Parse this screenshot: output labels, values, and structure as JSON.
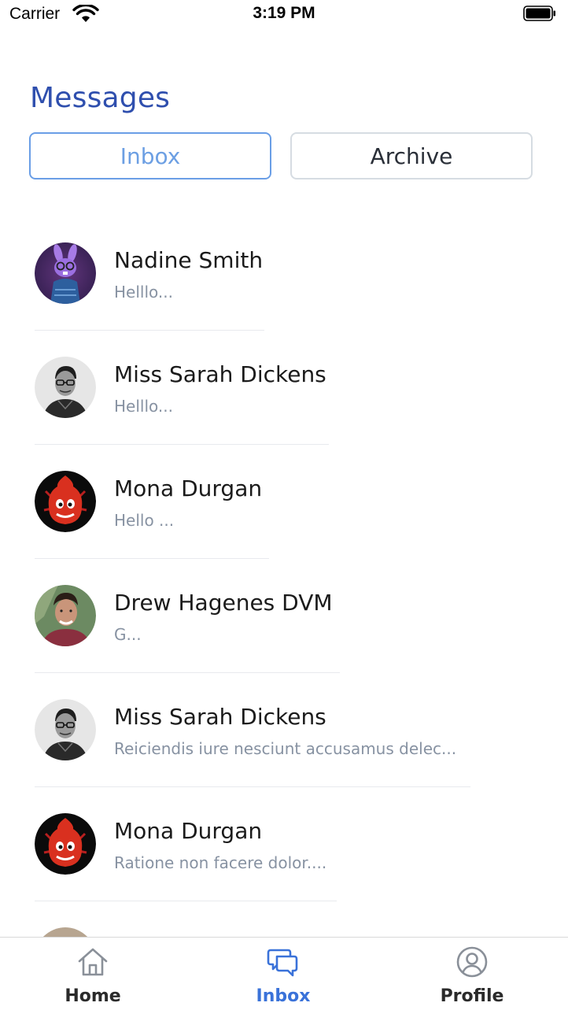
{
  "status_bar": {
    "carrier": "Carrier",
    "time": "3:19 PM",
    "wifi_icon": "wifi-icon",
    "battery_icon": "battery-icon"
  },
  "header": {
    "title": "Messages",
    "tabs": [
      {
        "label": "Inbox",
        "active": true
      },
      {
        "label": "Archive",
        "active": false
      }
    ]
  },
  "messages": [
    {
      "name": "Nadine Smith",
      "preview": "Helllo...",
      "avatar": "purple-bunny-avatar"
    },
    {
      "name": "Miss Sarah Dickens",
      "preview": "Helllo...",
      "avatar": "bw-man-glasses-avatar"
    },
    {
      "name": "Mona Durgan",
      "preview": "Hello ...",
      "avatar": "red-monster-avatar"
    },
    {
      "name": "Drew Hagenes DVM",
      "preview": "G...",
      "avatar": "smiling-man-avatar"
    },
    {
      "name": "Miss Sarah Dickens",
      "preview": "Reiciendis iure nesciunt accusamus delec...",
      "avatar": "bw-man-glasses-avatar"
    },
    {
      "name": "Mona Durgan",
      "preview": "Ratione non facere dolor....",
      "avatar": "red-monster-avatar"
    },
    {
      "name": "",
      "preview": "",
      "avatar": "partial-avatar"
    }
  ],
  "tab_bar": {
    "items": [
      {
        "label": "Home",
        "icon": "home-icon",
        "active": false
      },
      {
        "label": "Inbox",
        "icon": "chat-icon",
        "active": true
      },
      {
        "label": "Profile",
        "icon": "user-circle-icon",
        "active": false
      }
    ]
  },
  "colors": {
    "title": "#2f4fae",
    "active_tab": "#6c9fe3",
    "active_tab_bar": "#3a72d9",
    "preview_text": "#8792a2"
  }
}
